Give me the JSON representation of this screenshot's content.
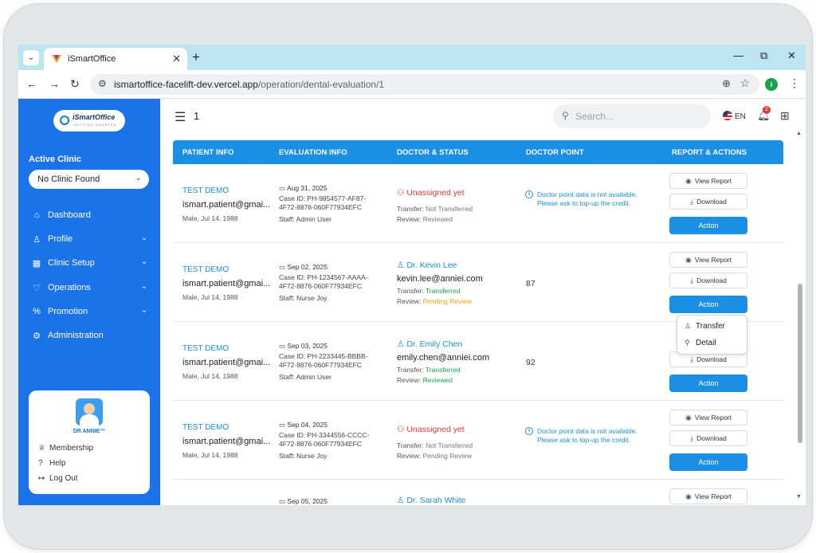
{
  "browser": {
    "tab_title": "iSmartOffice",
    "url_domain": "ismartoffice-facelift-dev.vercel.app",
    "url_path": "/operation/dental-evaluation/1",
    "profile_initial": "i"
  },
  "sidebar": {
    "logo_text": "iSmartOffice",
    "logo_tagline": "GETTING SMARTER",
    "active_clinic_label": "Active Clinic",
    "clinic_select_value": "No Clinic Found",
    "items": [
      {
        "label": "Dashboard",
        "icon": "home-icon"
      },
      {
        "label": "Profile",
        "icon": "user-icon"
      },
      {
        "label": "Clinic Setup",
        "icon": "building-icon"
      },
      {
        "label": "Operations",
        "icon": "tooth-icon"
      },
      {
        "label": "Promotion",
        "icon": "percent-icon"
      },
      {
        "label": "Administration",
        "icon": "gear-icon"
      }
    ],
    "user": {
      "name": "DR ANNIE™",
      "links": [
        {
          "label": "Membership",
          "icon": "crown-icon"
        },
        {
          "label": "Help",
          "icon": "help-icon"
        },
        {
          "label": "Log Out",
          "icon": "logout-icon"
        }
      ]
    }
  },
  "header": {
    "page_number": "1",
    "search_placeholder": "Search...",
    "language": "EN",
    "notification_count": "2"
  },
  "table": {
    "columns": [
      "PATIENT INFO",
      "EVALUATION INFO",
      "DOCTOR & STATUS",
      "DOCTOR POINT",
      "REPORT & ACTIONS"
    ],
    "rows": [
      {
        "patient_name": "TEST DEMO",
        "patient_email": "ismart.patient@gmai...",
        "patient_dob": "Male, Jul 14, 1988",
        "date": "Aug 31, 2025",
        "case_id": "Case ID: PH-9854577-AF87-4F72-8876-060F77934EFC",
        "staff": "Staff: Admin User",
        "doctor": "Unassigned yet",
        "doctor_email": "",
        "transfer_label": "Transfer:",
        "transfer": "Not Transferred",
        "review_label": "Review:",
        "review": "Reviewed",
        "point": "",
        "point_note": "Doctor point data is not available. Please ask to top-up the credit."
      },
      {
        "patient_name": "TEST DEMO",
        "patient_email": "ismart.patient@gmai...",
        "patient_dob": "Male, Jul 14, 1988",
        "date": "Sep 02, 2025",
        "case_id": "Case ID: PH-1234567-AAAA-4F72-8876-060F77934EFC",
        "staff": "Staff: Nurse Joy",
        "doctor": "Dr. Kevin Lee",
        "doctor_email": "kevin.lee@anniei.com",
        "transfer_label": "Transfer:",
        "transfer": "Transferred",
        "review_label": "Review:",
        "review": "Pending Review",
        "point": "87",
        "point_note": ""
      },
      {
        "patient_name": "TEST DEMO",
        "patient_email": "ismart.patient@gmai...",
        "patient_dob": "Male, Jul 14, 1988",
        "date": "Sep 03, 2025",
        "case_id": "Case ID: PH-2233445-BBBB-4F72-8876-060F77934EFC",
        "staff": "Staff: Admin User",
        "doctor": "Dr. Emily Chen",
        "doctor_email": "emily.chen@anniei.com",
        "transfer_label": "Transfer:",
        "transfer": "Transferred",
        "review_label": "Review:",
        "review": "Reviewed",
        "point": "92",
        "point_note": ""
      },
      {
        "patient_name": "TEST DEMO",
        "patient_email": "ismart.patient@gmai...",
        "patient_dob": "Male, Jul 14, 1988",
        "date": "Sep 04, 2025",
        "case_id": "Case ID: PH-3344556-CCCC-4F72-8876-060F77934EFC",
        "staff": "Staff: Nurse Joy",
        "doctor": "Unassigned yet",
        "doctor_email": "",
        "transfer_label": "Transfer:",
        "transfer": "Not Transferred",
        "review_label": "Review:",
        "review": "Pending Review",
        "point": "",
        "point_note": "Doctor point data is not available. Please ask to top-up the credit."
      },
      {
        "patient_name": "",
        "patient_email": "",
        "patient_dob": "",
        "date": "Sep 05, 2025",
        "case_id": "",
        "staff": "",
        "doctor": "Dr. Sarah White",
        "doctor_email": "",
        "point": "",
        "point_note": ""
      }
    ],
    "buttons": {
      "view_report": "View Report",
      "download": "Download",
      "action": "Action"
    }
  },
  "action_menu": {
    "items": [
      {
        "label": "Transfer",
        "icon": "user-icon"
      },
      {
        "label": "Detail",
        "icon": "search-icon"
      }
    ]
  },
  "colors": {
    "brand_blue": "#1a73e8",
    "header_blue": "#1a8fe3",
    "unassigned_red": "#e53935",
    "success_green": "#16a34a",
    "pending_orange": "#f59e0b"
  }
}
